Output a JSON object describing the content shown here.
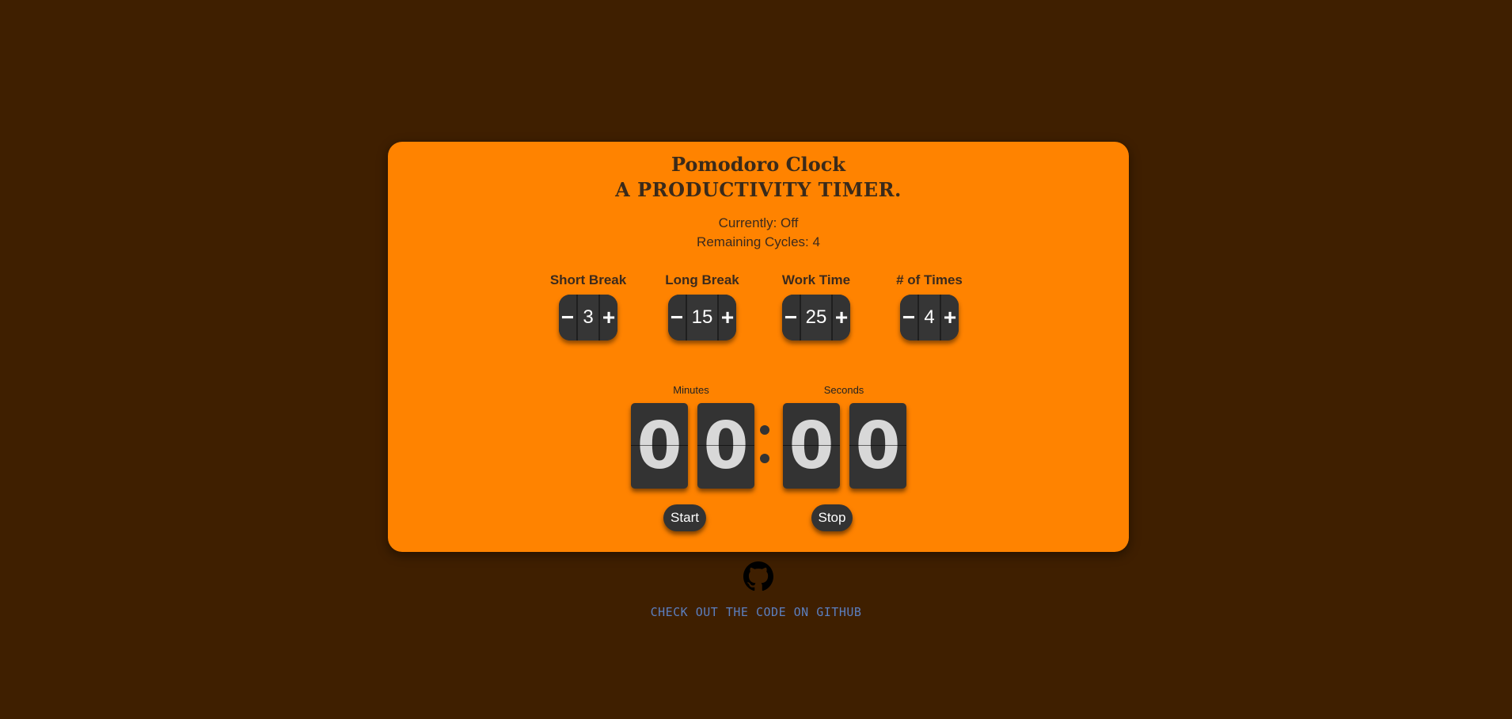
{
  "header": {
    "title": "Pomodoro Clock",
    "subtitle": "A PRODUCTIVITY TIMER."
  },
  "status": {
    "currently": "Currently: Off",
    "remaining_cycles": "Remaining Cycles: 4"
  },
  "settings": [
    {
      "label": "Short Break",
      "value": "3",
      "minus": "−",
      "plus": "+"
    },
    {
      "label": "Long Break",
      "value": "15",
      "minus": "−",
      "plus": "+"
    },
    {
      "label": "Work Time",
      "value": "25",
      "minus": "−",
      "plus": "+"
    },
    {
      "label": "# of Times",
      "value": "4",
      "minus": "−",
      "plus": "+"
    }
  ],
  "timer": {
    "minutes_label": "Minutes",
    "seconds_label": "Seconds",
    "digits": [
      "0",
      "0",
      "0",
      "0"
    ]
  },
  "controls": {
    "start_label": "Start",
    "stop_label": "Stop"
  },
  "footer": {
    "icon": "github-icon",
    "link_text": "CHECK OUT THE CODE ON GITHUB"
  },
  "colors": {
    "background": "#3f1f00",
    "card": "#ff8300",
    "widget": "#333333",
    "link": "#5b7fbf"
  }
}
